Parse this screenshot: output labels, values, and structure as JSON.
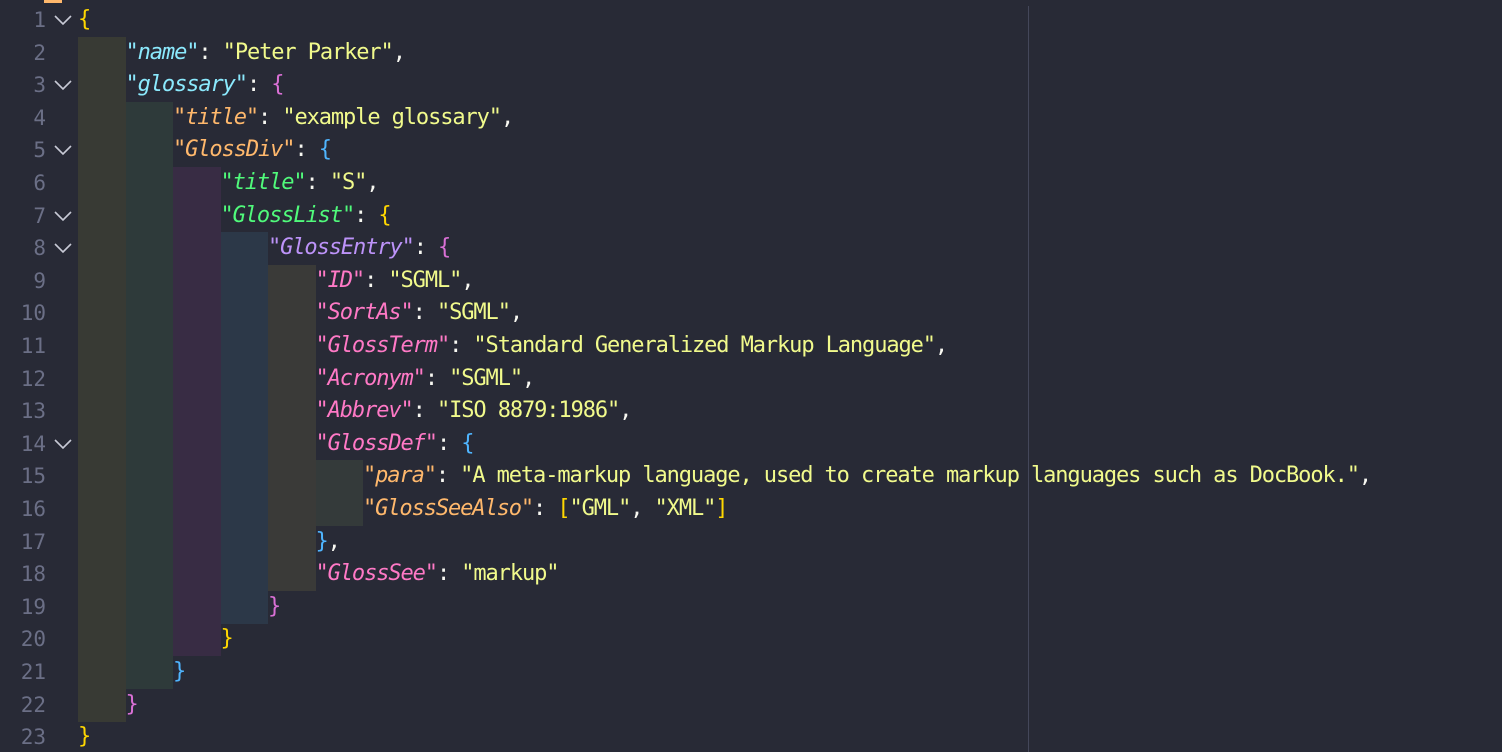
{
  "editor": {
    "language": "json",
    "colors": {
      "background": "#282a36",
      "line_number": "#6b6f86",
      "string_value": "#f1fa8c",
      "bracket_level1": "#ffd700",
      "bracket_level2": "#da70d6",
      "bracket_level3": "#4fb5ff",
      "key_level1": "#8be9fd",
      "key_level2": "#ffb86c",
      "key_level3": "#50fa7b",
      "key_level4": "#bd93f9",
      "key_level5": "#ff79c6"
    },
    "lines": [
      {
        "n": "1",
        "indent": 0,
        "fold": true,
        "parts": [
          {
            "t": "{",
            "c": "#ffd700"
          }
        ]
      },
      {
        "n": "2",
        "indent": 1,
        "fold": false,
        "parts": [
          {
            "t": "\"name\"",
            "c": "#8be9fd",
            "k": true
          },
          {
            "t": ": ",
            "c": "#f8f8f2"
          },
          {
            "t": "\"Peter Parker\"",
            "c": "#f1fa8c"
          },
          {
            "t": ",",
            "c": "#f8f8f2"
          }
        ]
      },
      {
        "n": "3",
        "indent": 1,
        "fold": true,
        "parts": [
          {
            "t": "\"glossary\"",
            "c": "#8be9fd",
            "k": true
          },
          {
            "t": ": ",
            "c": "#f8f8f2"
          },
          {
            "t": "{",
            "c": "#da70d6"
          }
        ]
      },
      {
        "n": "4",
        "indent": 2,
        "fold": false,
        "parts": [
          {
            "t": "\"title\"",
            "c": "#ffb86c",
            "k": true
          },
          {
            "t": ": ",
            "c": "#f8f8f2"
          },
          {
            "t": "\"example glossary\"",
            "c": "#f1fa8c"
          },
          {
            "t": ",",
            "c": "#f8f8f2"
          }
        ]
      },
      {
        "n": "5",
        "indent": 2,
        "fold": true,
        "parts": [
          {
            "t": "\"GlossDiv\"",
            "c": "#ffb86c",
            "k": true
          },
          {
            "t": ": ",
            "c": "#f8f8f2"
          },
          {
            "t": "{",
            "c": "#4fb5ff"
          }
        ]
      },
      {
        "n": "6",
        "indent": 3,
        "fold": false,
        "parts": [
          {
            "t": "\"title\"",
            "c": "#50fa7b",
            "k": true
          },
          {
            "t": ": ",
            "c": "#f8f8f2"
          },
          {
            "t": "\"S\"",
            "c": "#f1fa8c"
          },
          {
            "t": ",",
            "c": "#f8f8f2"
          }
        ]
      },
      {
        "n": "7",
        "indent": 3,
        "fold": true,
        "parts": [
          {
            "t": "\"GlossList\"",
            "c": "#50fa7b",
            "k": true
          },
          {
            "t": ": ",
            "c": "#f8f8f2"
          },
          {
            "t": "{",
            "c": "#ffd700"
          }
        ]
      },
      {
        "n": "8",
        "indent": 4,
        "fold": true,
        "parts": [
          {
            "t": "\"GlossEntry\"",
            "c": "#bd93f9",
            "k": true
          },
          {
            "t": ": ",
            "c": "#f8f8f2"
          },
          {
            "t": "{",
            "c": "#da70d6"
          }
        ]
      },
      {
        "n": "9",
        "indent": 5,
        "fold": false,
        "parts": [
          {
            "t": "\"ID\"",
            "c": "#ff79c6",
            "k": true
          },
          {
            "t": ": ",
            "c": "#f8f8f2"
          },
          {
            "t": "\"SGML\"",
            "c": "#f1fa8c"
          },
          {
            "t": ",",
            "c": "#f8f8f2"
          }
        ]
      },
      {
        "n": "10",
        "indent": 5,
        "fold": false,
        "parts": [
          {
            "t": "\"SortAs\"",
            "c": "#ff79c6",
            "k": true
          },
          {
            "t": ": ",
            "c": "#f8f8f2"
          },
          {
            "t": "\"SGML\"",
            "c": "#f1fa8c"
          },
          {
            "t": ",",
            "c": "#f8f8f2"
          }
        ]
      },
      {
        "n": "11",
        "indent": 5,
        "fold": false,
        "parts": [
          {
            "t": "\"GlossTerm\"",
            "c": "#ff79c6",
            "k": true
          },
          {
            "t": ": ",
            "c": "#f8f8f2"
          },
          {
            "t": "\"Standard Generalized Markup Language\"",
            "c": "#f1fa8c"
          },
          {
            "t": ",",
            "c": "#f8f8f2"
          }
        ]
      },
      {
        "n": "12",
        "indent": 5,
        "fold": false,
        "parts": [
          {
            "t": "\"Acronym\"",
            "c": "#ff79c6",
            "k": true
          },
          {
            "t": ": ",
            "c": "#f8f8f2"
          },
          {
            "t": "\"SGML\"",
            "c": "#f1fa8c"
          },
          {
            "t": ",",
            "c": "#f8f8f2"
          }
        ]
      },
      {
        "n": "13",
        "indent": 5,
        "fold": false,
        "parts": [
          {
            "t": "\"Abbrev\"",
            "c": "#ff79c6",
            "k": true
          },
          {
            "t": ": ",
            "c": "#f8f8f2"
          },
          {
            "t": "\"ISO 8879:1986\"",
            "c": "#f1fa8c"
          },
          {
            "t": ",",
            "c": "#f8f8f2"
          }
        ]
      },
      {
        "n": "14",
        "indent": 5,
        "fold": true,
        "parts": [
          {
            "t": "\"GlossDef\"",
            "c": "#ff79c6",
            "k": true
          },
          {
            "t": ": ",
            "c": "#f8f8f2"
          },
          {
            "t": "{",
            "c": "#4fb5ff"
          }
        ]
      },
      {
        "n": "15",
        "indent": 6,
        "fold": false,
        "parts": [
          {
            "t": "\"para\"",
            "c": "#ffb86c",
            "k": true
          },
          {
            "t": ": ",
            "c": "#f8f8f2"
          },
          {
            "t": "\"A meta-markup language, used to create markup languages such as DocBook.\"",
            "c": "#f1fa8c"
          },
          {
            "t": ",",
            "c": "#f8f8f2"
          }
        ]
      },
      {
        "n": "16",
        "indent": 6,
        "fold": false,
        "parts": [
          {
            "t": "\"GlossSeeAlso\"",
            "c": "#ffb86c",
            "k": true
          },
          {
            "t": ": ",
            "c": "#f8f8f2"
          },
          {
            "t": "[",
            "c": "#ffd700"
          },
          {
            "t": "\"GML\"",
            "c": "#f1fa8c"
          },
          {
            "t": ", ",
            "c": "#f8f8f2"
          },
          {
            "t": "\"XML\"",
            "c": "#f1fa8c"
          },
          {
            "t": "]",
            "c": "#ffd700"
          }
        ]
      },
      {
        "n": "17",
        "indent": 5,
        "fold": false,
        "parts": [
          {
            "t": "}",
            "c": "#4fb5ff"
          },
          {
            "t": ",",
            "c": "#f8f8f2"
          }
        ]
      },
      {
        "n": "18",
        "indent": 5,
        "fold": false,
        "parts": [
          {
            "t": "\"GlossSee\"",
            "c": "#ff79c6",
            "k": true
          },
          {
            "t": ": ",
            "c": "#f8f8f2"
          },
          {
            "t": "\"markup\"",
            "c": "#f1fa8c"
          }
        ]
      },
      {
        "n": "19",
        "indent": 4,
        "fold": false,
        "parts": [
          {
            "t": "}",
            "c": "#da70d6"
          }
        ]
      },
      {
        "n": "20",
        "indent": 3,
        "fold": false,
        "parts": [
          {
            "t": "}",
            "c": "#ffd700"
          }
        ]
      },
      {
        "n": "21",
        "indent": 2,
        "fold": false,
        "parts": [
          {
            "t": "}",
            "c": "#4fb5ff"
          }
        ]
      },
      {
        "n": "22",
        "indent": 1,
        "fold": false,
        "parts": [
          {
            "t": "}",
            "c": "#da70d6"
          }
        ]
      },
      {
        "n": "23",
        "indent": 0,
        "fold": false,
        "parts": [
          {
            "t": "}",
            "c": "#ffd700"
          }
        ]
      }
    ]
  }
}
